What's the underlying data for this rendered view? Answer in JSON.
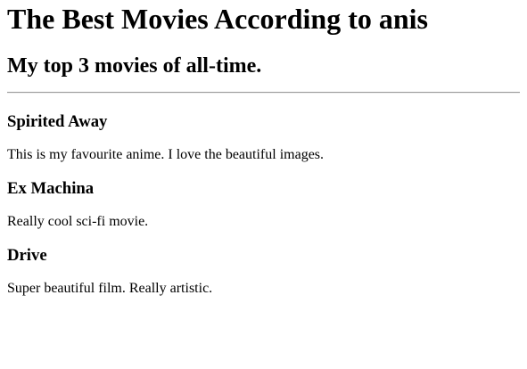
{
  "header": {
    "title": "The Best Movies According to anis",
    "subtitle": "My top 3 movies of all-time."
  },
  "movies": [
    {
      "title": "Spirited Away",
      "description": "This is my favourite anime. I love the beautiful images."
    },
    {
      "title": "Ex Machina",
      "description": "Really cool sci-fi movie."
    },
    {
      "title": "Drive",
      "description": "Super beautiful film. Really artistic."
    }
  ]
}
